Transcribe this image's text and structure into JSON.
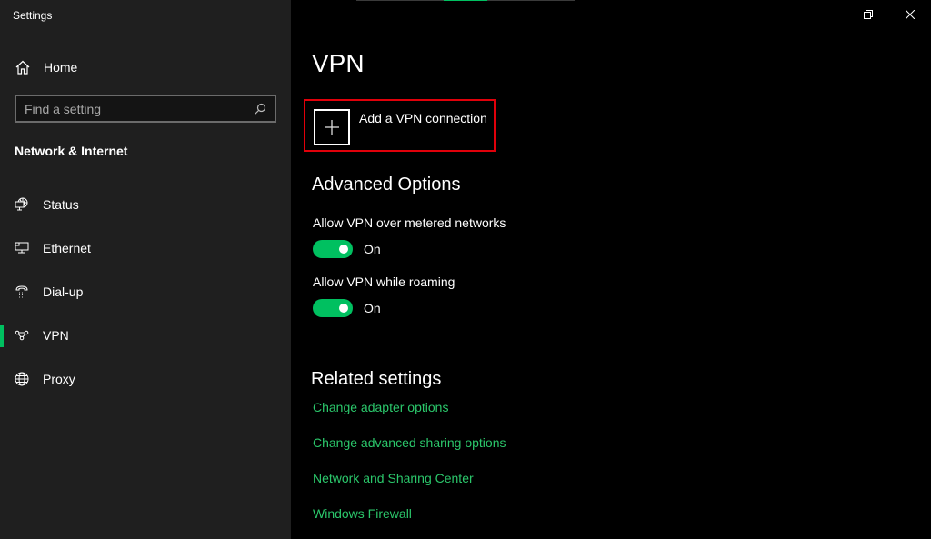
{
  "window": {
    "title": "Settings",
    "controls": {
      "minimize": "minimize-icon",
      "restore": "restore-icon",
      "close": "close-icon"
    }
  },
  "sidebar": {
    "home_label": "Home",
    "search_placeholder": "Find a setting",
    "section_title": "Network & Internet",
    "items": [
      {
        "label": "Status",
        "icon": "globe-monitor-icon",
        "selected": false
      },
      {
        "label": "Ethernet",
        "icon": "ethernet-icon",
        "selected": false
      },
      {
        "label": "Dial-up",
        "icon": "phone-icon",
        "selected": false
      },
      {
        "label": "VPN",
        "icon": "vpn-icon",
        "selected": true
      },
      {
        "label": "Proxy",
        "icon": "globe-icon",
        "selected": false
      }
    ]
  },
  "main": {
    "title": "VPN",
    "add_vpn_label": "Add a VPN connection",
    "advanced_title": "Advanced Options",
    "options": [
      {
        "label": "Allow VPN over metered networks",
        "state": "On",
        "on": true
      },
      {
        "label": "Allow VPN while roaming",
        "state": "On",
        "on": true
      }
    ],
    "related_title": "Related settings",
    "links": [
      "Change adapter options",
      "Change advanced sharing options",
      "Network and Sharing Center",
      "Windows Firewall"
    ]
  },
  "colors": {
    "accent": "#00c060",
    "link": "#2bc76b",
    "highlight_box": "#e0000a",
    "sidebar_bg": "#1f1f1f",
    "main_bg": "#000000"
  }
}
